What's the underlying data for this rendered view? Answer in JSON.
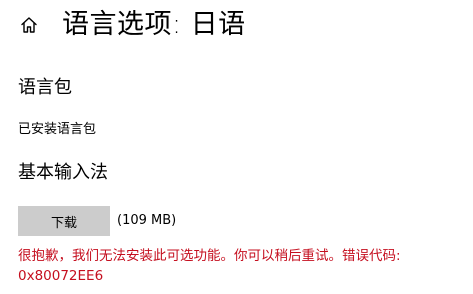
{
  "header": {
    "home_icon": "home-icon",
    "title": "语言选项: 日语"
  },
  "language_pack": {
    "title": "语言包",
    "status": "已安装语言包"
  },
  "input_method": {
    "title": "基本输入法",
    "download_label": "下载",
    "download_size": "(109 MB)"
  },
  "error": {
    "message": "很抱歉，我们无法安装此可选功能。你可以稍后重试。错误代码: 0x80072EE6",
    "color": "#c50f1f"
  },
  "colors": {
    "button_background": "#cccccc",
    "text": "#000000",
    "error": "#c50f1f"
  }
}
